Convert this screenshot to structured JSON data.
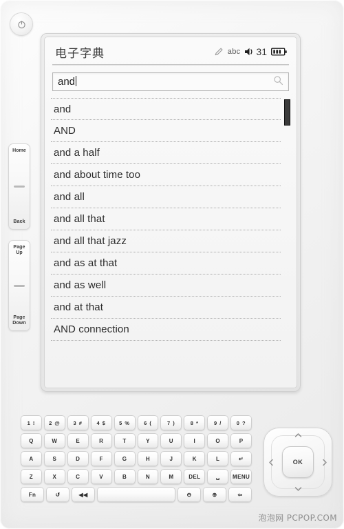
{
  "device": {
    "power_button_icon": "power-icon",
    "left_buttons": [
      {
        "top_label": "Home",
        "bottom_label": "Back"
      },
      {
        "top_label": "Page\nUp",
        "bottom_label": "Page\nDown"
      }
    ],
    "watermark": "泡泡网 PCPOP.COM"
  },
  "screen": {
    "title": "电子字典",
    "status": {
      "stylus_icon": "pencil-icon",
      "input_mode": "abc",
      "speaker_icon": "speaker-icon",
      "volume": "31",
      "battery_icon": "battery-icon",
      "battery_bars": 3
    },
    "search": {
      "value": "and",
      "placeholder": "",
      "icon": "search-icon"
    },
    "results": [
      {
        "label": "and"
      },
      {
        "label": "AND"
      },
      {
        "label": "and a half"
      },
      {
        "label": "and about time too"
      },
      {
        "label": "and all"
      },
      {
        "label": "and all that"
      },
      {
        "label": "and all that jazz"
      },
      {
        "label": "and as at that"
      },
      {
        "label": "and as well"
      },
      {
        "label": "and at that"
      },
      {
        "label": "AND connection"
      }
    ],
    "scrollbar": {
      "thumb_position": "top"
    }
  },
  "keyboard": {
    "rows": [
      [
        {
          "label": "1 !",
          "name": "key-1"
        },
        {
          "label": "2 @",
          "name": "key-2"
        },
        {
          "label": "3 #",
          "name": "key-3"
        },
        {
          "label": "4 $",
          "name": "key-4"
        },
        {
          "label": "5 %",
          "name": "key-5"
        },
        {
          "label": "6 (",
          "name": "key-6"
        },
        {
          "label": "7 )",
          "name": "key-7"
        },
        {
          "label": "8 *",
          "name": "key-8"
        },
        {
          "label": "9 /",
          "name": "key-9"
        },
        {
          "label": "0 ?",
          "name": "key-0"
        }
      ],
      [
        {
          "label": "Q",
          "name": "key-q"
        },
        {
          "label": "W",
          "name": "key-w"
        },
        {
          "label": "E",
          "name": "key-e"
        },
        {
          "label": "R",
          "name": "key-r"
        },
        {
          "label": "T",
          "name": "key-t"
        },
        {
          "label": "Y",
          "name": "key-y"
        },
        {
          "label": "U",
          "name": "key-u"
        },
        {
          "label": "I",
          "name": "key-i"
        },
        {
          "label": "O",
          "name": "key-o"
        },
        {
          "label": "P",
          "name": "key-p"
        }
      ],
      [
        {
          "label": "A",
          "name": "key-a"
        },
        {
          "label": "S",
          "name": "key-s"
        },
        {
          "label": "D",
          "name": "key-d"
        },
        {
          "label": "F",
          "name": "key-f"
        },
        {
          "label": "G",
          "name": "key-g"
        },
        {
          "label": "H",
          "name": "key-h"
        },
        {
          "label": "J",
          "name": "key-j"
        },
        {
          "label": "K",
          "name": "key-k"
        },
        {
          "label": "L",
          "name": "key-l"
        },
        {
          "label": "↵",
          "name": "key-enter"
        }
      ],
      [
        {
          "label": "Z",
          "name": "key-z"
        },
        {
          "label": "X",
          "name": "key-x"
        },
        {
          "label": "C",
          "name": "key-c"
        },
        {
          "label": "V",
          "name": "key-v"
        },
        {
          "label": "B",
          "name": "key-b"
        },
        {
          "label": "N",
          "name": "key-n"
        },
        {
          "label": "M",
          "name": "key-m"
        },
        {
          "label": "DEL",
          "name": "key-delete"
        },
        {
          "label": "␣",
          "name": "key-space-small"
        },
        {
          "label": "MENU",
          "name": "key-menu"
        }
      ],
      [
        {
          "label": "Fn",
          "name": "key-fn"
        },
        {
          "label": "↺",
          "name": "key-refresh"
        },
        {
          "label": "◀◀",
          "name": "key-rewind"
        },
        {
          "label": "",
          "name": "key-spacebar"
        },
        {
          "label": "⊖",
          "name": "key-zoom-out"
        },
        {
          "label": "⊕",
          "name": "key-zoom-in"
        },
        {
          "label": "⇦",
          "name": "key-back"
        }
      ]
    ]
  },
  "dpad": {
    "ok_label": "OK",
    "up_icon": "chevron-up-icon",
    "down_icon": "chevron-down-icon",
    "left_icon": "chevron-left-icon",
    "right_icon": "chevron-right-icon"
  }
}
